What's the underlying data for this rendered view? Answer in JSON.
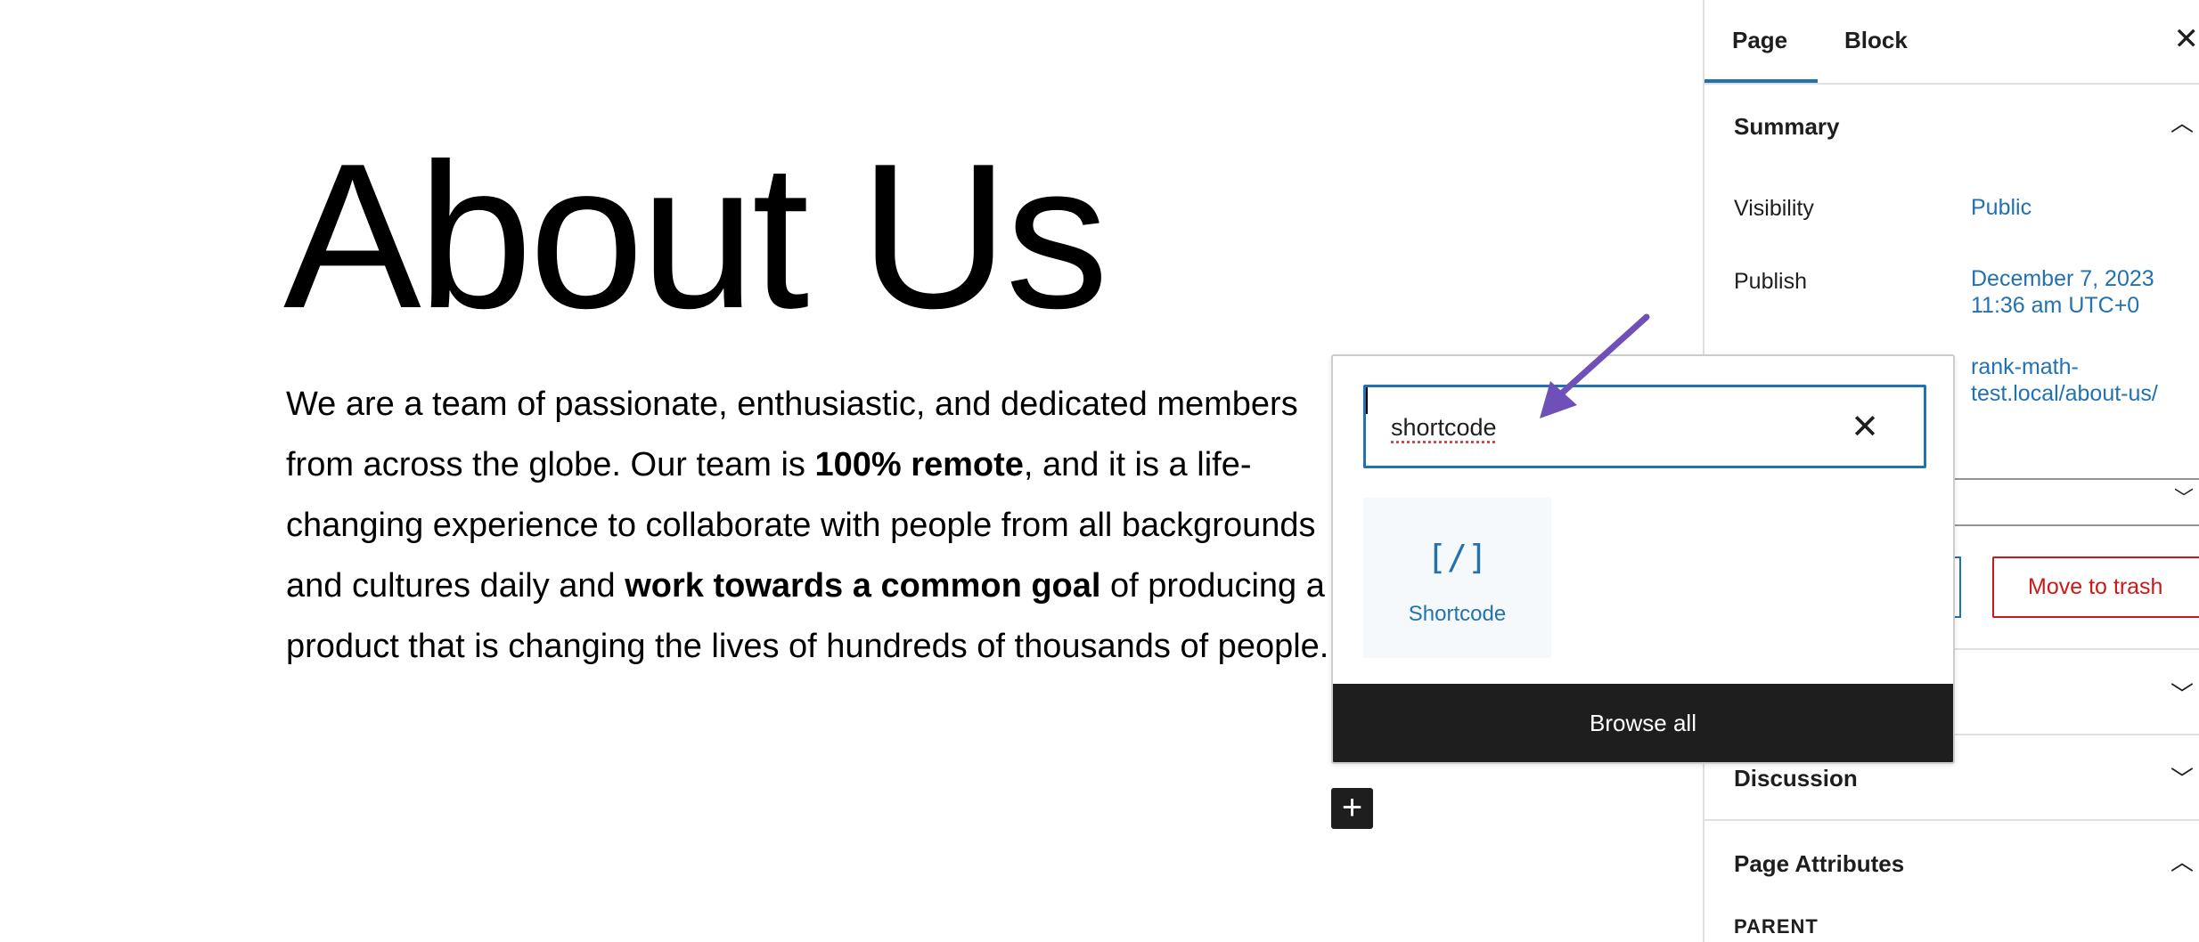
{
  "editor": {
    "title": "About Us",
    "paragraph": {
      "p1": "We are a team of passionate, enthusiastic, and dedicated members from across the globe. Our team is ",
      "b1": "100% remote",
      "p2": ", and it is a life-changing experience to collaborate with people from all backgrounds and cultures daily and ",
      "b2": "work towards a common goal",
      "p3": " of producing a product that is changing the lives of hundreds of thousands of people."
    },
    "add_block_icon": "plus-icon"
  },
  "inserter": {
    "search_value": "shortcode",
    "clear_icon": "close-icon",
    "results": [
      {
        "label": "Shortcode",
        "icon": "[/]"
      }
    ],
    "browse_all": "Browse all"
  },
  "sidebar": {
    "tabs": [
      "Page",
      "Block"
    ],
    "active_tab": "Page",
    "close_icon": "close-icon",
    "summary": {
      "heading": "Summary",
      "visibility_label": "Visibility",
      "visibility_value": "Public",
      "publish_label": "Publish",
      "publish_value_1": "December 7, 2023",
      "publish_value_2": "11:36 am UTC+0",
      "url_1": "rank-math-",
      "url_2": "test.local/about-us/",
      "trash": "Move to trash"
    },
    "discussion": "Discussion",
    "page_attributes": {
      "heading": "Page Attributes",
      "parent_label": "PARENT"
    }
  },
  "annotation": {
    "arrow_color": "#6f4fb8"
  },
  "colors": {
    "accent": "#2271b1",
    "danger": "#cc1818"
  }
}
